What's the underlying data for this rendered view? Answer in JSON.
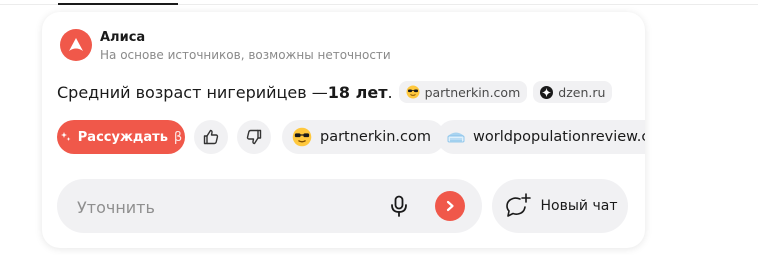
{
  "assistant": {
    "name": "Алиса",
    "disclaimer": "На основе источников, возможны неточности",
    "brand_color": "#f0584a"
  },
  "answer": {
    "text_prefix": "Средний возраст нигерийцев — ",
    "highlight": "18 лет",
    "text_suffix": ".",
    "sources": [
      {
        "label": "partnerkin.com",
        "icon": "sunglasses-emoji-icon"
      },
      {
        "label": "dzen.ru",
        "icon": "dzen-icon"
      }
    ]
  },
  "actions": {
    "reason_label": "Рассуждать",
    "reason_beta": "β",
    "like_icon": "thumbs-up-icon",
    "dislike_icon": "thumbs-down-icon",
    "source_chips": [
      {
        "label": "partnerkin.com",
        "icon": "sunglasses-emoji-icon"
      },
      {
        "label": "worldpopulationreview.com",
        "icon": "world-icon"
      }
    ]
  },
  "composer": {
    "placeholder": "Уточнить",
    "value": "",
    "new_chat_label": "Новый чат"
  }
}
